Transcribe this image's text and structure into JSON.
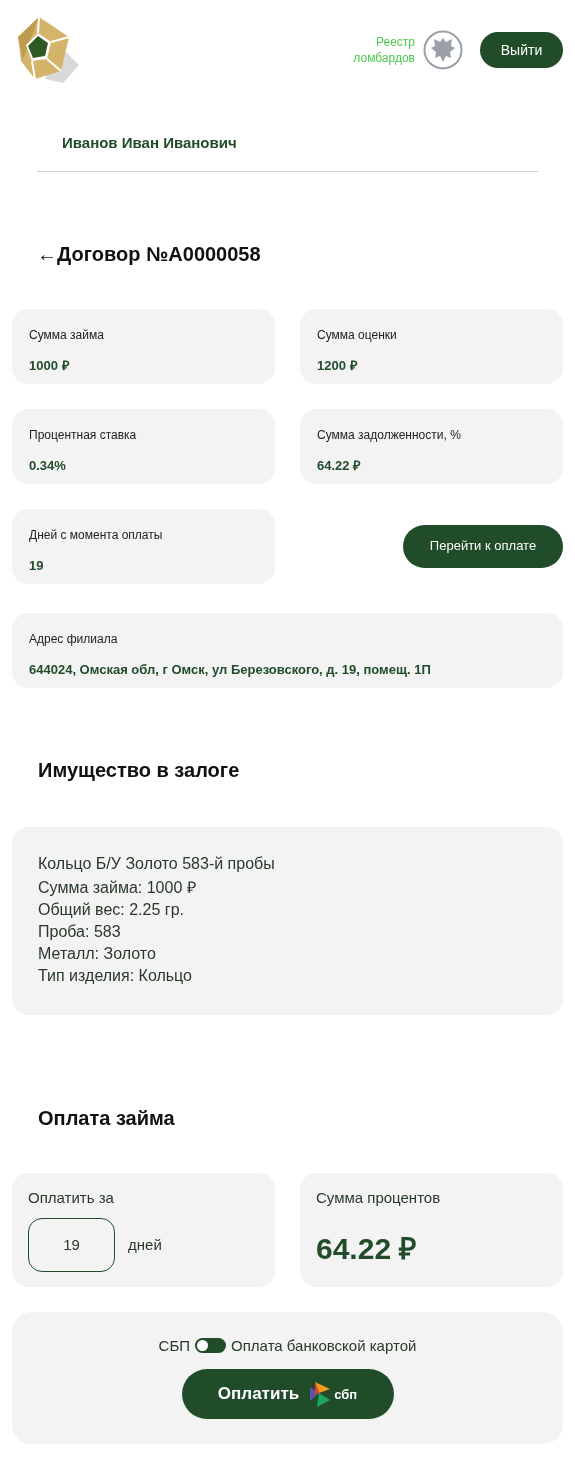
{
  "header": {
    "registry_link": "Реестр ломбардов",
    "logout_button": "Выйти"
  },
  "user": {
    "name": "Иванов Иван Иванович"
  },
  "contract": {
    "back_icon": "←",
    "title": "Договор №А0000058",
    "fields": [
      {
        "label": "Сумма займа",
        "value": "1000 ₽"
      },
      {
        "label": "Сумма оценки",
        "value": "1200 ₽"
      },
      {
        "label": "Процентная ставка",
        "value": "0.34%"
      },
      {
        "label": "Сумма задолженности, %",
        "value": "64.22 ₽"
      },
      {
        "label": "Дней с момента оплаты",
        "value": "19"
      }
    ],
    "pay_button": "Перейти к оплате",
    "address": {
      "label": "Адрес филиала",
      "value": "644024, Омская обл, г Омск, ул Березовского, д. 19, помещ. 1П"
    }
  },
  "collateral": {
    "title": "Имущество в залоге",
    "items": [
      {
        "name": "Кольцо Б/У Золото 583-й пробы",
        "details": [
          "Сумма займа: 1000 ₽",
          "Общий вес: 2.25 гр.",
          "Проба: 583",
          "Металл: Золото",
          "Тип изделия: Кольцо"
        ]
      }
    ]
  },
  "payment": {
    "title": "Оплата займа",
    "days_label": "Оплатить за",
    "days_value": "19",
    "days_unit": "дней",
    "interest_label": "Сумма процентов",
    "interest_value": "64.22 ₽",
    "method_left": "СБП",
    "method_toggle": {
      "on": false
    },
    "method_right": "Оплата банковской картой",
    "pay_button": "Оплатить",
    "sbp_logo_text": "сбп"
  }
}
